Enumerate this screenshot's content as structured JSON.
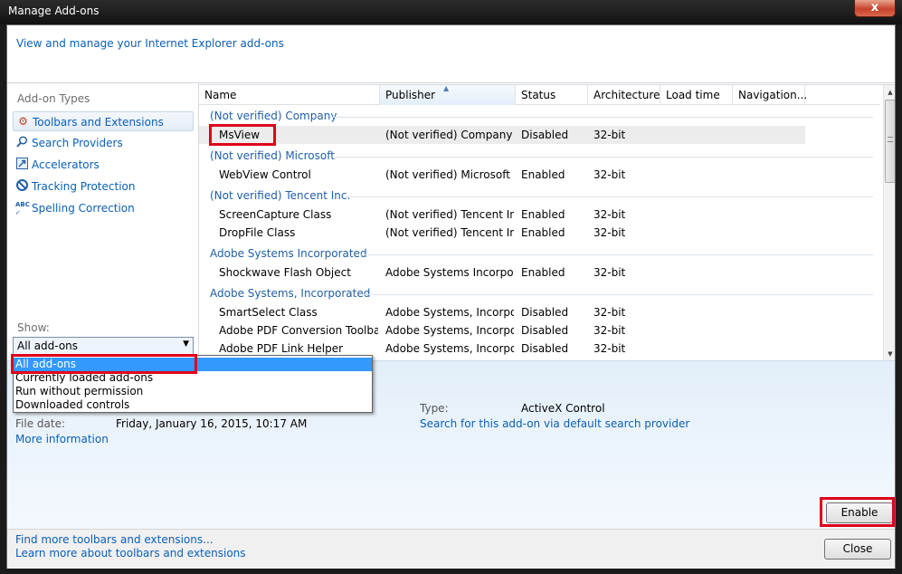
{
  "window": {
    "title": "Manage Add-ons",
    "close_glyph": "x"
  },
  "header": {
    "link": "View and manage your Internet Explorer add-ons"
  },
  "left": {
    "types_label": "Add-on Types",
    "types": [
      {
        "label": "Toolbars and Extensions",
        "icon": "gear-icon",
        "selected": true
      },
      {
        "label": "Search Providers",
        "icon": "search-icon"
      },
      {
        "label": "Accelerators",
        "icon": "accelerator-icon"
      },
      {
        "label": "Tracking Protection",
        "icon": "tracking-protection-icon"
      },
      {
        "label": "Spelling Correction",
        "icon": "spelling-icon"
      }
    ],
    "show_label": "Show:",
    "show_value": "All add-ons"
  },
  "table": {
    "columns": [
      "Name",
      "Publisher",
      "Status",
      "Architecture",
      "Load time",
      "Navigation..."
    ],
    "groups": [
      {
        "title": "(Not verified) Company",
        "rows": [
          [
            "MsView",
            "(Not verified) Company",
            "Disabled",
            "32-bit"
          ]
        ]
      },
      {
        "title": "(Not verified) Microsoft",
        "rows": [
          [
            "WebView Control",
            "(Not verified) Microsoft",
            "Enabled",
            "32-bit"
          ]
        ]
      },
      {
        "title": "(Not verified) Tencent Inc.",
        "rows": [
          [
            "ScreenCapture Class",
            "(Not verified) Tencent Inc.",
            "Enabled",
            "32-bit"
          ],
          [
            "DropFile Class",
            "(Not verified) Tencent Inc.",
            "Enabled",
            "32-bit"
          ]
        ]
      },
      {
        "title": "Adobe Systems Incorporated",
        "rows": [
          [
            "Shockwave Flash Object",
            "Adobe Systems Incorpor...",
            "Enabled",
            "32-bit"
          ]
        ]
      },
      {
        "title": "Adobe Systems, Incorporated",
        "rows": [
          [
            "SmartSelect Class",
            "Adobe Systems, Incorpo...",
            "Disabled",
            "32-bit"
          ],
          [
            "Adobe PDF Conversion Toolbar...",
            "Adobe Systems, Incorpo...",
            "Disabled",
            "32-bit"
          ],
          [
            "Adobe PDF Link Helper",
            "Adobe Systems, Incorpo...",
            "Disabled",
            "32-bit"
          ]
        ]
      }
    ]
  },
  "details": {
    "type_label": "Type:",
    "type_value": "ActiveX Control",
    "search_link": "Search for this add-on via default search provider",
    "file_date_label": "File date:",
    "file_date_value": "Friday, January 16, 2015, 10:17 AM",
    "more_info": "More information"
  },
  "dropdown": {
    "options": [
      "All add-ons",
      "Currently loaded add-ons",
      "Run without permission",
      "Downloaded controls"
    ]
  },
  "footer": {
    "link1": "Find more toolbars and extensions...",
    "link2": "Learn more about toolbars and extensions",
    "enable": "Enable",
    "close": "Close"
  },
  "colors": {
    "link": "#0b5fb6",
    "highlight": "#e0001b",
    "selection": "#3399ff"
  }
}
